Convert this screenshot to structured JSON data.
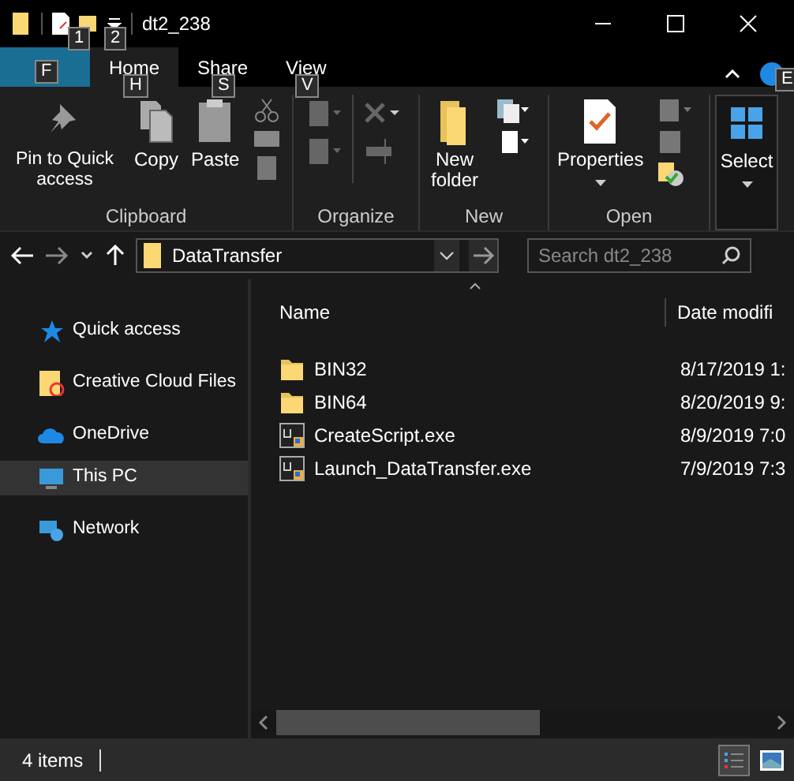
{
  "window": {
    "title": "dt2_238",
    "quick_access_keytips": [
      "1",
      "2"
    ]
  },
  "tabs": [
    {
      "kind": "file",
      "keytip": "F",
      "selected": false
    },
    {
      "kind": "tab",
      "label": "Home",
      "keytip": "H",
      "selected": true
    },
    {
      "kind": "tab",
      "label": "Share",
      "keytip": "S",
      "selected": false
    },
    {
      "kind": "tab",
      "label": "View",
      "keytip": "V",
      "selected": false
    }
  ],
  "help_keytip": "E",
  "ribbon_groups": [
    {
      "label": "Clipboard",
      "commands": [
        {
          "label": "Pin to Quick access"
        },
        {
          "label": "Copy"
        },
        {
          "label": "Paste"
        }
      ]
    },
    {
      "label": "Organize"
    },
    {
      "label": "New",
      "commands": [
        {
          "label": "New folder"
        }
      ]
    },
    {
      "label": "Open",
      "commands": [
        {
          "label": "Properties"
        }
      ]
    },
    {
      "commands": [
        {
          "label": "Select"
        }
      ]
    }
  ],
  "address": {
    "path": "DataTransfer",
    "search_placeholder": "Search dt2_238"
  },
  "sidebar": {
    "items": [
      {
        "label": "Quick access",
        "selected": false
      },
      {
        "label": "Creative Cloud Files",
        "selected": false
      },
      {
        "label": "OneDrive",
        "selected": false
      },
      {
        "label": "This PC",
        "selected": true
      },
      {
        "label": "Network",
        "selected": false
      }
    ]
  },
  "table": {
    "columns": [
      "Name",
      "Date modifi"
    ],
    "rows": [
      {
        "kind": "folder",
        "name": "BIN32",
        "date": "8/17/2019 1:"
      },
      {
        "kind": "folder",
        "name": "BIN64",
        "date": "8/20/2019 9:"
      },
      {
        "kind": "exe",
        "name": "CreateScript.exe",
        "date": "8/9/2019 7:0"
      },
      {
        "kind": "exe",
        "name": "Launch_DataTransfer.exe",
        "date": "7/9/2019 7:3"
      }
    ]
  },
  "status_bar": {
    "count": "4 items"
  }
}
